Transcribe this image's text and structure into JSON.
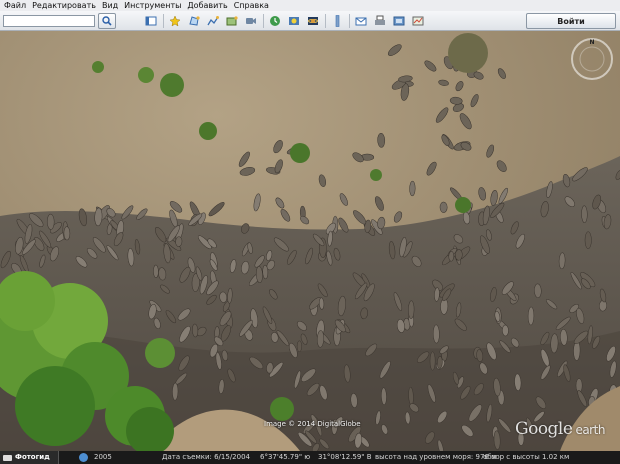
{
  "menu": [
    "Файл",
    "Редактировать",
    "Вид",
    "Инструменты",
    "Добавить",
    "Справка"
  ],
  "toolbar": {
    "search_placeholder": "",
    "login_label": "Войти",
    "icons": [
      "sidebar-toggle-icon",
      "placemark-icon",
      "polygon-icon",
      "path-icon",
      "image-overlay-icon",
      "record-tour-icon",
      "historical-imagery-icon",
      "sun-icon",
      "planets-icon",
      "ruler-icon",
      "email-icon",
      "print-icon",
      "save-image-icon",
      "view-in-maps-icon"
    ]
  },
  "map": {
    "copyright": "Image © 2014 DigitalGlobe",
    "logo": "Google",
    "logo_suffix": "earth",
    "compass_letter": "N"
  },
  "status": {
    "photos_label": "Фотогид",
    "year": "2005",
    "imagery_date": "Дата съемки: 6/15/2004",
    "latitude": "6°37'45.79\" ю",
    "longitude": "31°08'12.59\" В",
    "elevation": "высота над уровнем моря:  976 м",
    "eye_alt": "обзор с высоты  1.02 км"
  },
  "colors": {
    "ground": "#a08e72",
    "mud": "#5e574e",
    "foliage": "#4f8a2c",
    "toolbar": "#e6e9ee"
  }
}
